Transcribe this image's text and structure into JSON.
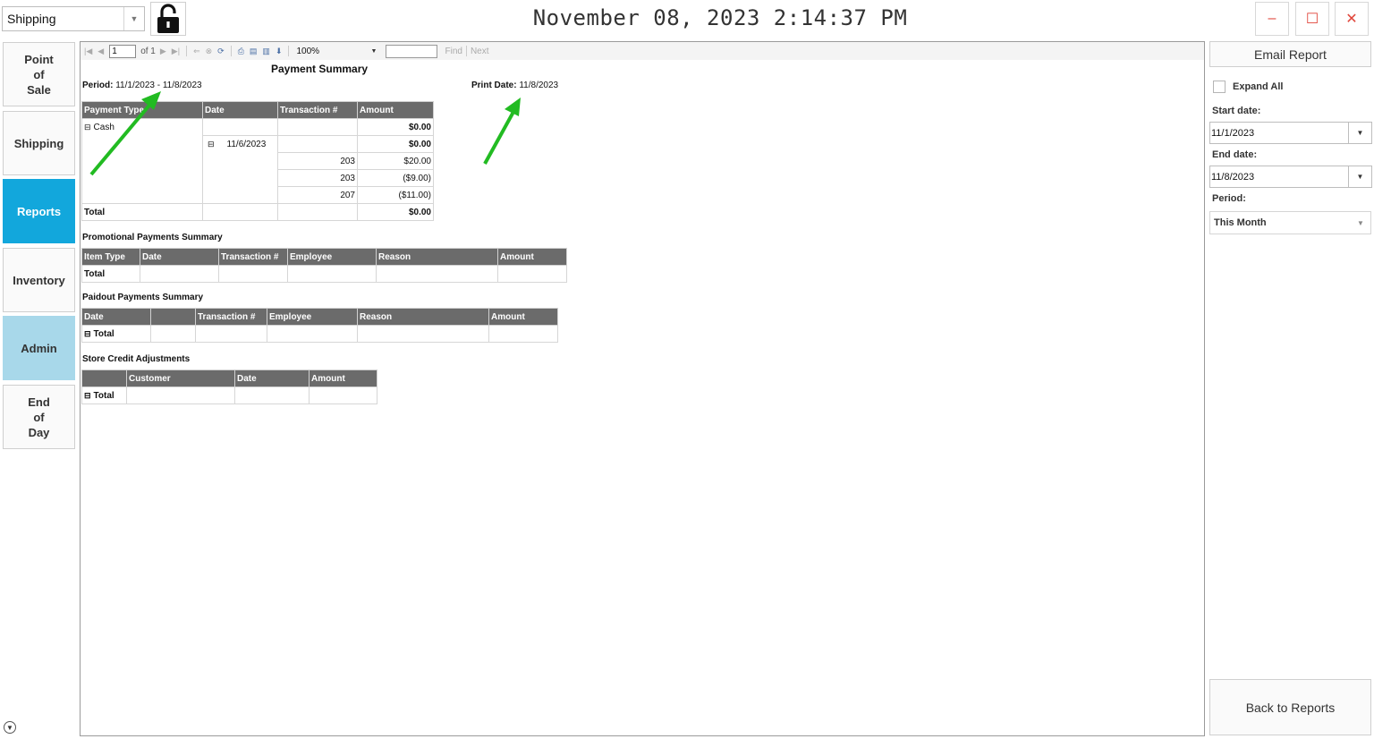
{
  "header": {
    "station": "Shipping",
    "datetime": "November 08, 2023 2:14:37 PM",
    "minimize": "–",
    "maximize": "☐",
    "close": "✕"
  },
  "nav": [
    {
      "label": "Point\nof\nSale"
    },
    {
      "label": "Shipping"
    },
    {
      "label": "Reports"
    },
    {
      "label": "Inventory"
    },
    {
      "label": "Admin"
    },
    {
      "label": "End\nof\nDay"
    }
  ],
  "toolbar": {
    "page": "1",
    "of_label": "of 1",
    "zoom": "100%",
    "find": "Find",
    "next": "Next"
  },
  "report": {
    "title": "Payment Summary",
    "period_label": "Period:",
    "period_value": "11/1/2023 - 11/8/2023",
    "print_label": "Print Date:",
    "print_value": "11/8/2023",
    "payment": {
      "headers": [
        "Payment Type",
        "Date",
        "Transaction #",
        "Amount"
      ],
      "cash": "Cash",
      "cash_amount": "$0.00",
      "date": "11/6/2023",
      "date_amount": "$0.00",
      "rows": [
        {
          "txn": "203",
          "amount": "$20.00"
        },
        {
          "txn": "203",
          "amount": "($9.00)"
        },
        {
          "txn": "207",
          "amount": "($11.00)"
        }
      ],
      "total_label": "Total",
      "total_amount": "$0.00"
    },
    "promo": {
      "title": "Promotional Payments Summary",
      "headers": [
        "Item Type",
        "Date",
        "Transaction #",
        "Employee",
        "Reason",
        "Amount"
      ],
      "total_label": "Total"
    },
    "paidout": {
      "title": "Paidout Payments Summary",
      "headers": [
        "Date",
        "",
        "Transaction #",
        "Employee",
        "Reason",
        "Amount"
      ],
      "total_label": "Total"
    },
    "credit": {
      "title": "Store Credit Adjustments",
      "headers": [
        "",
        "Customer",
        "Date",
        "Amount"
      ],
      "total_label": "Total"
    }
  },
  "right": {
    "email": "Email Report",
    "expand_all": "Expand All",
    "start_label": "Start date:",
    "start_value": "11/1/2023",
    "end_label": "End date:",
    "end_value": "11/8/2023",
    "period_label": "Period:",
    "period_value": "This Month",
    "back": "Back to Reports"
  },
  "colors": {
    "active_nav": "#12a7dc",
    "admin_nav": "#a8d8ea",
    "arrow": "#22bb22",
    "table_header": "#6b6b6b"
  }
}
